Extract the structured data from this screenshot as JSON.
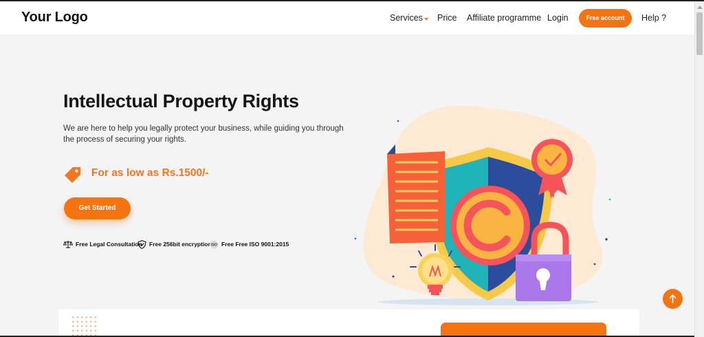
{
  "header": {
    "logo": "Your Logo",
    "nav": {
      "services": "Services",
      "price": "Price",
      "affiliate": "Affiliate programme",
      "login": "Login",
      "free_account": "Free account",
      "help": "Help ?"
    }
  },
  "hero": {
    "title": "Intellectual Property Rights",
    "description": "We are here to help you legally protect your business, while guiding you through the process of securing your rights.",
    "price_text": "For as low as Rs.1500/-",
    "cta": "Get Started",
    "features": [
      {
        "icon": "scales-icon",
        "label": "Free Legal Consultation"
      },
      {
        "icon": "shield-check-icon",
        "label": "Free 256bit encryption"
      },
      {
        "icon": "iso-badge-icon",
        "label": "Free Free ISO 9001:2015"
      }
    ],
    "illustration_icon": "copyright-shield-illustration"
  },
  "colors": {
    "accent": "#f5740f",
    "hero_bg": "#f4f4f4",
    "text": "#151515"
  }
}
